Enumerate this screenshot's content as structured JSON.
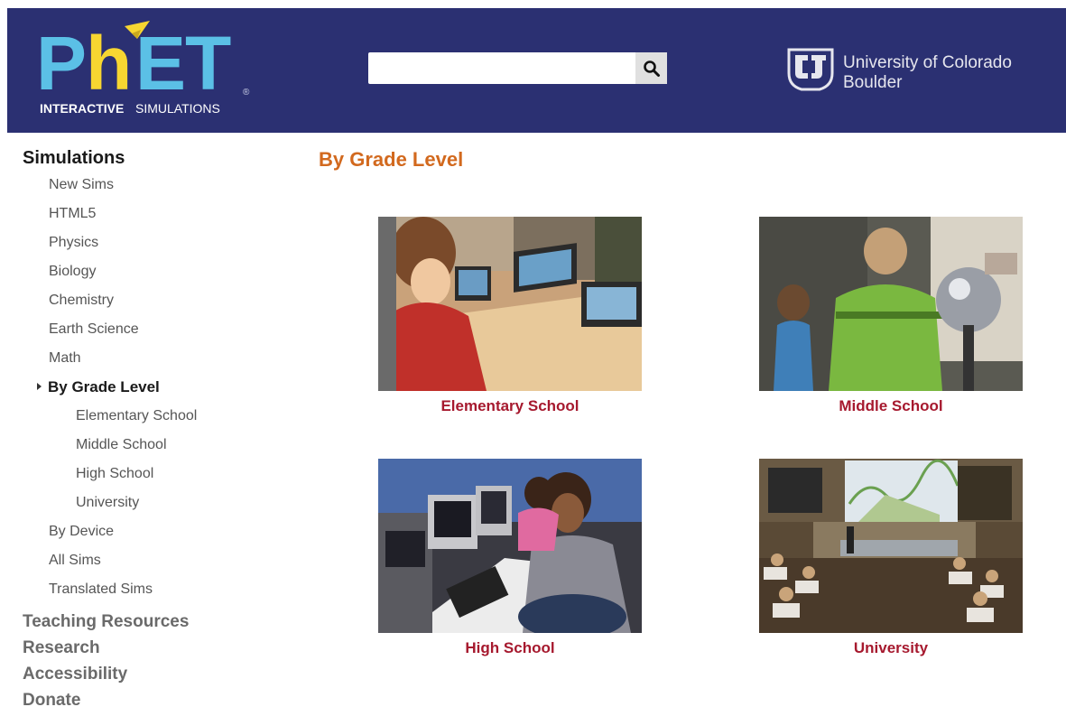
{
  "header": {
    "logo_main": "PhET",
    "logo_sub_bold": "INTERACTIVE",
    "logo_sub_rest": " SIMULATIONS",
    "search_placeholder": "",
    "search_icon": "magnifier-icon",
    "university_line1": "University of Colorado",
    "university_line2": "Boulder",
    "brand_blue": "#2b3072",
    "accent_yellow": "#f7d631",
    "accent_cyan": "#5bc0e6"
  },
  "sidebar": {
    "heading": "Simulations",
    "items": [
      {
        "label": "New Sims"
      },
      {
        "label": "HTML5"
      },
      {
        "label": "Physics"
      },
      {
        "label": "Biology"
      },
      {
        "label": "Chemistry"
      },
      {
        "label": "Earth Science"
      },
      {
        "label": "Math"
      }
    ],
    "active": {
      "label": "By Grade Level"
    },
    "subitems": [
      {
        "label": "Elementary School"
      },
      {
        "label": "Middle School"
      },
      {
        "label": "High School"
      },
      {
        "label": "University"
      }
    ],
    "after_items": [
      {
        "label": "By Device"
      },
      {
        "label": "All Sims"
      },
      {
        "label": "Translated Sims"
      }
    ],
    "sections": [
      {
        "label": "Teaching Resources"
      },
      {
        "label": "Research"
      },
      {
        "label": "Accessibility"
      },
      {
        "label": "Donate"
      }
    ]
  },
  "main": {
    "title": "By Grade Level",
    "title_color": "#d2691e",
    "caption_color": "#a6192e",
    "tiles": [
      {
        "caption": "Elementary School"
      },
      {
        "caption": "Middle School"
      },
      {
        "caption": "High School"
      },
      {
        "caption": "University"
      }
    ]
  }
}
